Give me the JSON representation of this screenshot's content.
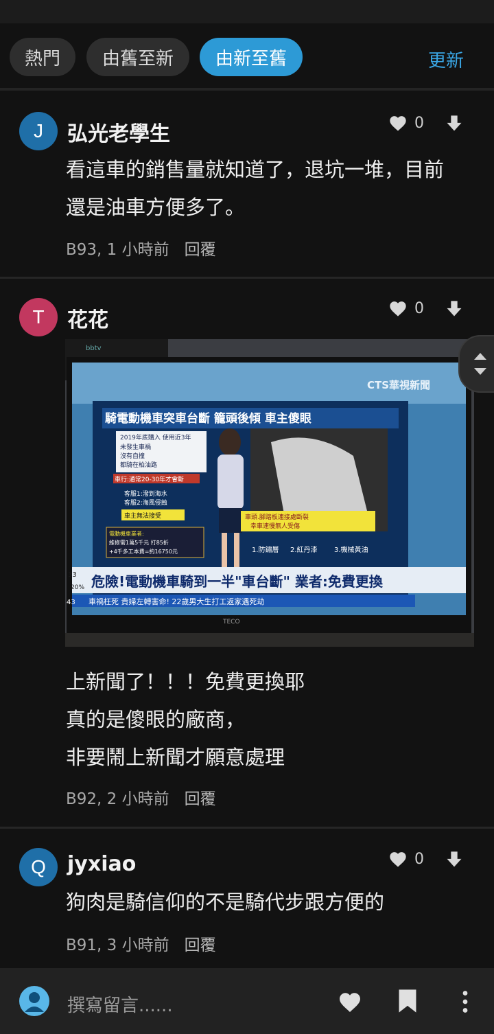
{
  "filters": {
    "hot": "熱門",
    "old_to_new": "由舊至新",
    "new_to_old": "由新至舊",
    "refresh": "更新"
  },
  "comments": [
    {
      "avatar_letter": "J",
      "avatar_color": "#1f6fa8",
      "username": "弘光老學生",
      "likes": "0",
      "lines": [
        "看這車的銷售量就知道了，退坑一堆，目前",
        "還是油車方便多了。"
      ],
      "floor_time": "B93, 1 小時前",
      "reply": "回覆"
    },
    {
      "avatar_letter": "T",
      "avatar_color": "#c2385f",
      "username": "花花",
      "likes": "0",
      "lines": [
        "上新聞了！！！免費更換耶",
        "真的是傻眼的廠商，",
        "非要鬧上新聞才願意處理"
      ],
      "floor_time": "B92, 2 小時前",
      "reply": "回覆",
      "photo": {
        "channel": "CTS華視新聞",
        "headline": "騎電動機車突車台斷 籠頭後傾 車主傻眼",
        "box_lines": [
          "2019年底購入 使用近3年",
          "未發生車禍",
          "沒有自撞",
          "都騎在柏油路"
        ],
        "red_note": "車行:通常20-30年才會斷",
        "service_lines": [
          "客服1:潑到海水",
          "客服2:海風侵蝕"
        ],
        "cannot_accept": "車主無法接受",
        "repair_lines": [
          "電動機車業者:",
          "維修需1萬5千元 打85折",
          "+4千多工本費=約16750元"
        ],
        "yellow_note": [
          "車頭.腳踏板連接處斷裂",
          "幸車速慢無人受傷"
        ],
        "bottom_items": [
          "1.防鏽層",
          "2.紅丹漆",
          "3.機械黃油"
        ],
        "ticker_main": "危險!電動機車騎到一半\"車台斷\" 業者:免費更換",
        "ticker_sub": "車禍枉死 貴婦左轉害命! 22歲男大生打工返家遇死劫",
        "ticker_left_top": "33",
        "ticker_left_mid": "20%",
        "ticker_left_bottom": "43",
        "tv_brand": "TECO",
        "box_brand": "bbtv"
      }
    },
    {
      "avatar_letter": "Q",
      "avatar_color": "#1f6fa8",
      "username": "jyxiao",
      "likes": "0",
      "lines": [
        "狗肉是騎信仰的不是騎代步跟方便的"
      ],
      "floor_time": "B91, 3 小時前",
      "reply": "回覆"
    }
  ],
  "bottom_bar": {
    "placeholder": "撰寫留言......"
  },
  "icons": [
    "heart-icon",
    "arrow-down-icon",
    "bookmark-icon",
    "more-vertical-icon",
    "scroll-arrows-icon"
  ]
}
